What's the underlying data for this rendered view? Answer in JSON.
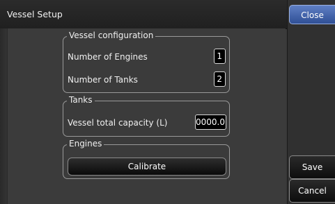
{
  "window": {
    "title": "Vessel Setup"
  },
  "buttons": {
    "close": "Close",
    "save": "Save",
    "cancel": "Cancel"
  },
  "vessel_configuration": {
    "title": "Vessel configuration",
    "engines_label": "Number of Engines",
    "engines_value": "1",
    "tanks_label": "Number of Tanks",
    "tanks_value": "2"
  },
  "tanks": {
    "title": "Tanks",
    "capacity_label": "Vessel total capacity (L)",
    "capacity_value": "0000.0"
  },
  "engines": {
    "title": "Engines",
    "calibrate_label": "Calibrate"
  },
  "colors": {
    "accent": "#3f5fa8",
    "background": "#3b3b3b",
    "titlebar": "#232323"
  }
}
